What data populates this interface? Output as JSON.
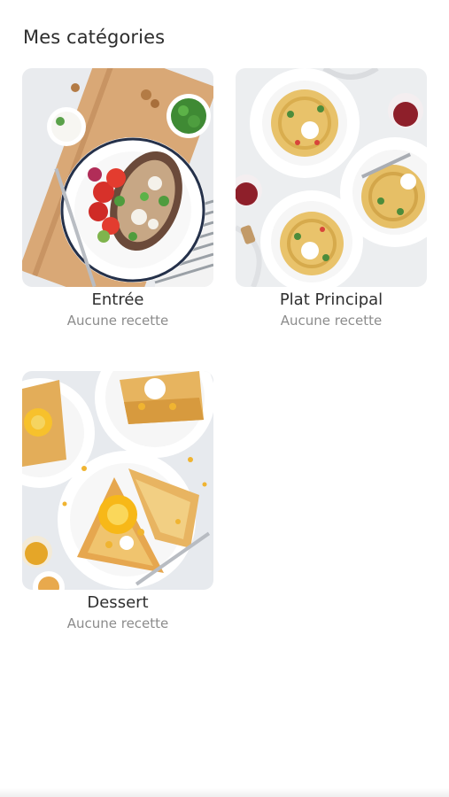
{
  "header": {
    "title": "Mes catégories"
  },
  "categories": [
    {
      "name": "Entrée",
      "count_label": "Aucune recette",
      "image": "roasted-eggplant-tomato-salad-photo"
    },
    {
      "name": "Plat Principal",
      "count_label": "Aucune recette",
      "image": "pasta-plates-wine-photo"
    },
    {
      "name": "Dessert",
      "count_label": "Aucune recette",
      "image": "crepes-orange-photo"
    }
  ],
  "colors": {
    "title": "#2d2d2d",
    "category_name": "#2f2f2f",
    "category_subtitle": "#8c8c8c",
    "background": "#ffffff"
  }
}
